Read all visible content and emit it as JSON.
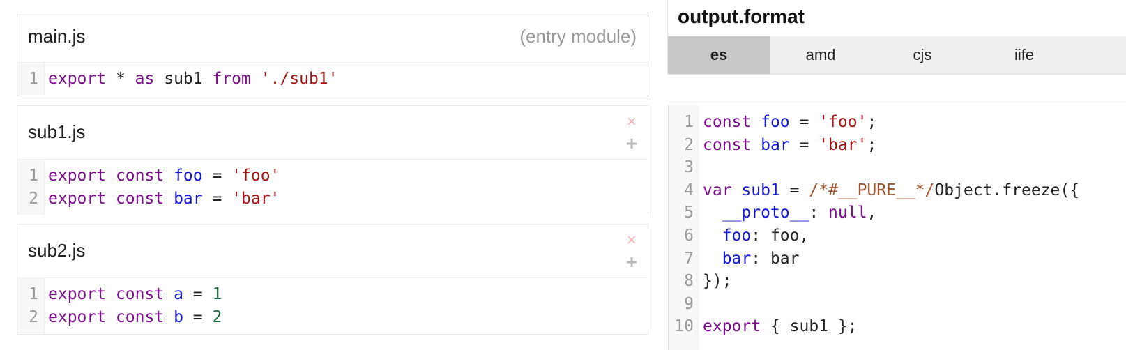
{
  "modules": [
    {
      "title": "main.js",
      "note": "(entry module)",
      "lines": [
        {
          "num": "1",
          "tokens": [
            {
              "t": "export",
              "c": "k"
            },
            {
              "t": " ",
              "c": "p"
            },
            {
              "t": "*",
              "c": "p"
            },
            {
              "t": " ",
              "c": "p"
            },
            {
              "t": "as",
              "c": "k"
            },
            {
              "t": " sub1 ",
              "c": "p"
            },
            {
              "t": "from",
              "c": "k"
            },
            {
              "t": " ",
              "c": "p"
            },
            {
              "t": "'./sub1'",
              "c": "s"
            }
          ]
        }
      ]
    },
    {
      "title": "sub1.js",
      "remove_icon": "×",
      "add_icon": "+",
      "lines": [
        {
          "num": "1",
          "tokens": [
            {
              "t": "export",
              "c": "k"
            },
            {
              "t": " ",
              "c": "p"
            },
            {
              "t": "const",
              "c": "k"
            },
            {
              "t": " ",
              "c": "p"
            },
            {
              "t": "foo",
              "c": "v"
            },
            {
              "t": " = ",
              "c": "p"
            },
            {
              "t": "'foo'",
              "c": "s"
            }
          ]
        },
        {
          "num": "2",
          "tokens": [
            {
              "t": "export",
              "c": "k"
            },
            {
              "t": " ",
              "c": "p"
            },
            {
              "t": "const",
              "c": "k"
            },
            {
              "t": " ",
              "c": "p"
            },
            {
              "t": "bar",
              "c": "v"
            },
            {
              "t": " = ",
              "c": "p"
            },
            {
              "t": "'bar'",
              "c": "s"
            }
          ]
        }
      ]
    },
    {
      "title": "sub2.js",
      "remove_icon": "×",
      "add_icon": "+",
      "lines": [
        {
          "num": "1",
          "tokens": [
            {
              "t": "export",
              "c": "k"
            },
            {
              "t": " ",
              "c": "p"
            },
            {
              "t": "const",
              "c": "k"
            },
            {
              "t": " ",
              "c": "p"
            },
            {
              "t": "a",
              "c": "v"
            },
            {
              "t": " = ",
              "c": "p"
            },
            {
              "t": "1",
              "c": "n"
            }
          ]
        },
        {
          "num": "2",
          "tokens": [
            {
              "t": "export",
              "c": "k"
            },
            {
              "t": " ",
              "c": "p"
            },
            {
              "t": "const",
              "c": "k"
            },
            {
              "t": " ",
              "c": "p"
            },
            {
              "t": "b",
              "c": "v"
            },
            {
              "t": " = ",
              "c": "p"
            },
            {
              "t": "2",
              "c": "n"
            }
          ]
        }
      ]
    }
  ],
  "output": {
    "title": "output.format",
    "formats": [
      "es",
      "amd",
      "cjs",
      "iife"
    ],
    "selected_format": "es",
    "lines": [
      {
        "num": "1",
        "tokens": [
          {
            "t": "const",
            "c": "k"
          },
          {
            "t": " ",
            "c": "p"
          },
          {
            "t": "foo",
            "c": "v"
          },
          {
            "t": " = ",
            "c": "p"
          },
          {
            "t": "'foo'",
            "c": "s"
          },
          {
            "t": ";",
            "c": "p"
          }
        ]
      },
      {
        "num": "2",
        "tokens": [
          {
            "t": "const",
            "c": "k"
          },
          {
            "t": " ",
            "c": "p"
          },
          {
            "t": "bar",
            "c": "v"
          },
          {
            "t": " = ",
            "c": "p"
          },
          {
            "t": "'bar'",
            "c": "s"
          },
          {
            "t": ";",
            "c": "p"
          }
        ]
      },
      {
        "num": "3",
        "tokens": []
      },
      {
        "num": "4",
        "tokens": [
          {
            "t": "var",
            "c": "k"
          },
          {
            "t": " ",
            "c": "p"
          },
          {
            "t": "sub1",
            "c": "v"
          },
          {
            "t": " = ",
            "c": "p"
          },
          {
            "t": "/*#__PURE__*/",
            "c": "c"
          },
          {
            "t": "Object.freeze({",
            "c": "p"
          }
        ]
      },
      {
        "num": "5",
        "tokens": [
          {
            "t": "  ",
            "c": "p"
          },
          {
            "t": "__proto__",
            "c": "v"
          },
          {
            "t": ": ",
            "c": "p"
          },
          {
            "t": "null",
            "c": "k"
          },
          {
            "t": ",",
            "c": "p"
          }
        ]
      },
      {
        "num": "6",
        "tokens": [
          {
            "t": "  ",
            "c": "p"
          },
          {
            "t": "foo",
            "c": "v"
          },
          {
            "t": ": foo,",
            "c": "p"
          }
        ]
      },
      {
        "num": "7",
        "tokens": [
          {
            "t": "  ",
            "c": "p"
          },
          {
            "t": "bar",
            "c": "v"
          },
          {
            "t": ": bar",
            "c": "p"
          }
        ]
      },
      {
        "num": "8",
        "tokens": [
          {
            "t": "});",
            "c": "p"
          }
        ]
      },
      {
        "num": "9",
        "tokens": []
      },
      {
        "num": "10",
        "tokens": [
          {
            "t": "export",
            "c": "k"
          },
          {
            "t": " { sub1 };",
            "c": "p"
          }
        ]
      }
    ]
  }
}
